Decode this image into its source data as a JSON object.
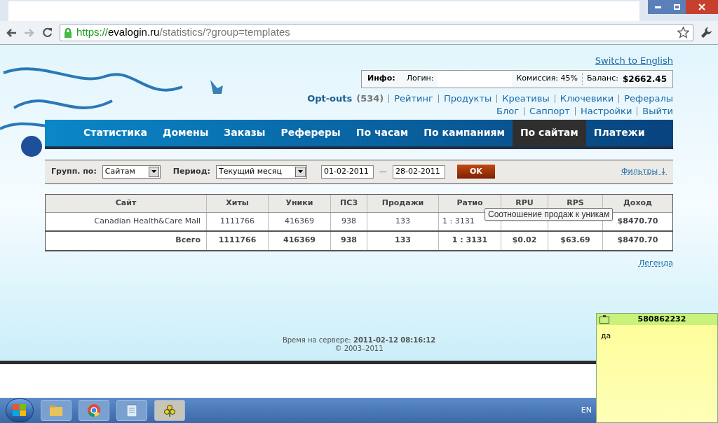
{
  "browser": {
    "url_scheme": "https://",
    "url_host": "evalogin.ru",
    "url_path": "/statistics/?group=templates"
  },
  "header": {
    "language_link": "Switch to English",
    "info_label": "Инфо:",
    "login_label": "Логин:",
    "commission": "Комиссия: 45%",
    "balance_label": "Баланс:",
    "balance": "$2662.45"
  },
  "links_row1": [
    {
      "label": "Opt-outs",
      "count": "(534)"
    },
    {
      "label": "Рейтинг"
    },
    {
      "label": "Продукты"
    },
    {
      "label": "Креативы"
    },
    {
      "label": "Ключевики"
    },
    {
      "label": "Рефералы"
    }
  ],
  "links_row2": [
    {
      "label": "Блог"
    },
    {
      "label": "Саппорт"
    },
    {
      "label": "Настройки"
    },
    {
      "label": "Выйти"
    }
  ],
  "nav": [
    {
      "label": "Статистика",
      "selected": false
    },
    {
      "label": "Домены",
      "selected": false
    },
    {
      "label": "Заказы",
      "selected": false
    },
    {
      "label": "Рефереры",
      "selected": false
    },
    {
      "label": "По часам",
      "selected": false
    },
    {
      "label": "По кампаниям",
      "selected": false
    },
    {
      "label": "По сайтам",
      "selected": true
    },
    {
      "label": "Платежи",
      "selected": false
    }
  ],
  "filters": {
    "group_label": "Групп. по:",
    "group_value": "Сайтам",
    "period_label": "Период:",
    "period_value": "Текущий месяц",
    "date_from": "01-02-2011",
    "date_sep": "—",
    "date_to": "28-02-2011",
    "ok_button": "OK",
    "filters_link": "Фильтры ↓"
  },
  "table": {
    "columns": [
      "Сайт",
      "Хиты",
      "Уники",
      "ПСЗ",
      "Продажи",
      "Ратио",
      "RPU",
      "RPS",
      "Доход"
    ],
    "rows": [
      [
        "Canadian Health&Care Mall",
        "1111766",
        "416369",
        "938",
        "133",
        "1 : 3131",
        null,
        null,
        "$8470.70"
      ]
    ],
    "total": [
      "Всего",
      "1111766",
      "416369",
      "938",
      "133",
      "1 : 3131",
      "$0.02",
      "$63.69",
      "$8470.70"
    ]
  },
  "tooltip": "Соотношение продаж к уникам",
  "legend_link": "Легенда",
  "footer": {
    "server_time_label": "Время на сервере:",
    "server_time": "2011-02-12 08:16:12",
    "copyright": "© 2003–2011"
  },
  "taskbar": {
    "language": "EN"
  },
  "sticky_note": {
    "title": "580862232",
    "text": "да"
  }
}
